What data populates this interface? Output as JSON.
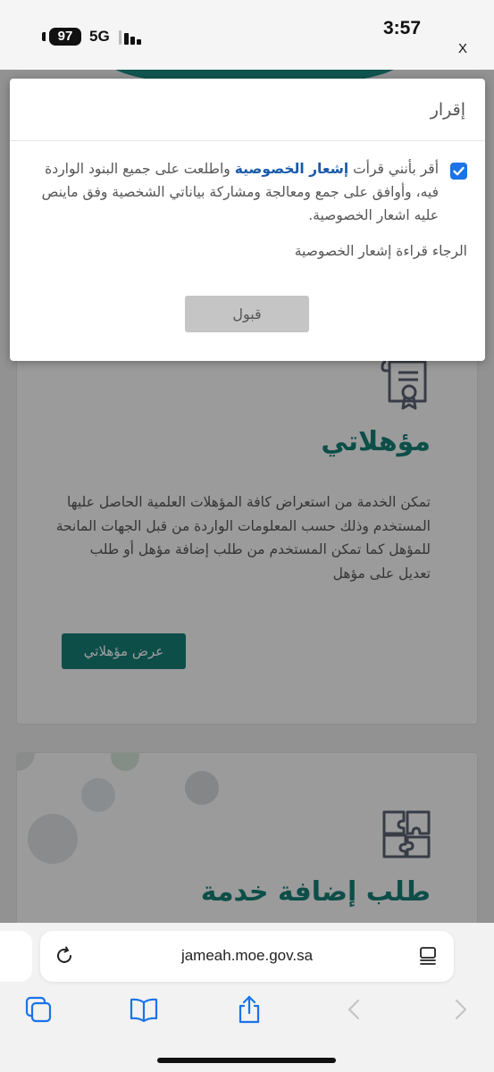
{
  "status_bar": {
    "battery": "97",
    "network": "5G",
    "time": "3:57",
    "close_label": "X"
  },
  "modal": {
    "title": "إقرار",
    "consent_before_link": "أقر بأنني قرأت ",
    "consent_link": "إشعار الخصوصية",
    "consent_after_link": " واطلعت على جميع البنود الواردة فيه، وأوافق على جمع ومعالجة ومشاركة بياناتي الشخصية وفق ماينص عليه اشعار الخصوصية.",
    "checkbox_checked": true,
    "hint": "الرجاء قراءة إشعار الخصوصية",
    "accept_button": "قبول"
  },
  "cards": [
    {
      "title": "مؤهلاتي",
      "description": "تمكن الخدمة من استعراض كافة المؤهلات العلمية الحاصل عليها المستخدم وذلك حسب المعلومات الواردة من قبل الجهات المانحة للمؤهل كما تمكن المستخدم من طلب إضافة مؤهل أو طلب تعديل على مؤهل",
      "button": "عرض مؤهلاتي",
      "icon": "certificate-icon"
    },
    {
      "title": "طلب إضافة خدمة",
      "icon": "puzzle-icon"
    }
  ],
  "browser": {
    "url": "jameah.moe.gov.sa"
  },
  "colors": {
    "accent": "#177f76",
    "checkbox": "#1a73e8",
    "link": "#1a5aa8",
    "toolbar_icon": "#1a73e8"
  }
}
